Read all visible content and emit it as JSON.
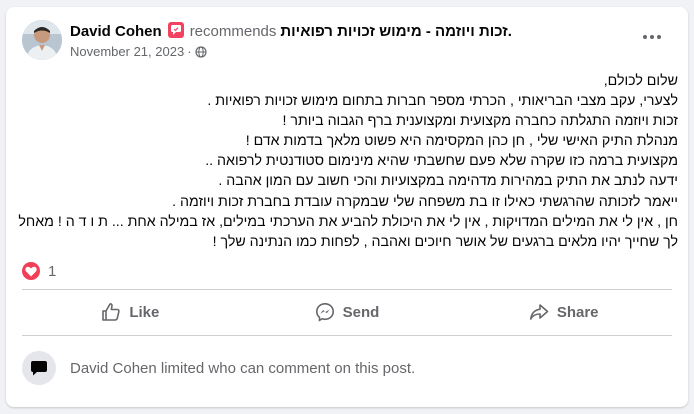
{
  "post": {
    "author": "David Cohen",
    "action": "recommends",
    "page": "זכות ויוזמה - מימוש זכויות רפואיות.",
    "date": "November 21, 2023",
    "separator": "·",
    "privacy_icon": "globe-icon",
    "more_icon": "more-options-icon",
    "body_lines": [
      "שלום לכולם,",
      "לצערי, עקב מצבי הבריאותי , הכרתי מספר חברות בתחום מימוש זכויות רפואיות .",
      "זכות ויוזמה התגלתה כחברה מקצועית ומקצוענית ברף הגבוה ביותר !",
      "מנהלת התיק האישי שלי , חן כהן המקסימה היא פשוט מלאך בדמות אדם !",
      "מקצועית ברמה כזו שקרה שלא פעם שחשבתי שהיא מינימום סטודנטית לרפואה ..",
      "ידעה לנתב את התיק במהירות מדהימה במקצועיות והכי חשוב עם המון אהבה .",
      "ייאמר לזכותה שהרגשתי כאילו זו בת משפחה שלי שבמקרה עובדת בחברת זכות ויוזמה .",
      "חן , אין לי את המילים המדויקות , אין לי את היכולת להביע את הערכתי במילים, אז במילה אחת ... ת ו ד ה ! מאחל",
      "לך שחייך יהיו מלאים ברגעים של אושר חיוכים ואהבה , לפחות כמו הנתינה שלך !"
    ]
  },
  "reactions": {
    "icon": "heart-icon",
    "count": "1"
  },
  "actions": {
    "like": "Like",
    "send": "Send",
    "share": "Share"
  },
  "notice": {
    "icon": "comment-bubble-icon",
    "text": "David Cohen limited who can comment on this post."
  },
  "colors": {
    "background": "#f0f2f5",
    "card": "#ffffff",
    "secondary_text": "#65676b",
    "recommend_badge": "#f3425f",
    "heart": "#f33e58",
    "divider": "#ced0d4"
  }
}
